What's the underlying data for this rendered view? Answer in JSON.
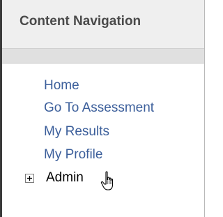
{
  "header": {
    "title": "Content Navigation"
  },
  "nav": {
    "items": [
      {
        "label": "Home"
      },
      {
        "label": "Go To Assessment"
      },
      {
        "label": "My Results"
      },
      {
        "label": "My Profile"
      }
    ],
    "admin": {
      "label": "Admin",
      "icon": "plus-square-icon"
    }
  },
  "cursor": {
    "icon": "hand-pointer-icon"
  },
  "colors": {
    "link": "#3c5f9b",
    "header_bg": "#efefef",
    "band_bg": "#e0e0e0",
    "left_border": "#3a3a3a"
  }
}
